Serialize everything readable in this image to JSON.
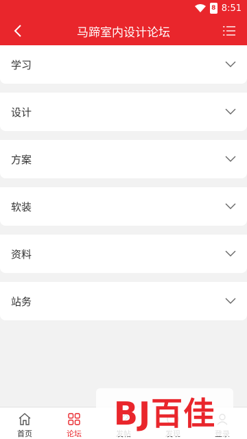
{
  "status_bar": {
    "time": "8:51",
    "battery": "8"
  },
  "header": {
    "title": "马蹄室内设计论坛"
  },
  "categories": [
    {
      "label": "学习"
    },
    {
      "label": "设计"
    },
    {
      "label": "方案"
    },
    {
      "label": "软装"
    },
    {
      "label": "资料"
    },
    {
      "label": "站务"
    }
  ],
  "tabbar": {
    "items": [
      {
        "label": "首页",
        "icon": "home-icon"
      },
      {
        "label": "论坛",
        "icon": "grid-icon"
      },
      {
        "label": "发帖",
        "icon": "post-icon"
      },
      {
        "label": "发现",
        "icon": "discover-icon"
      },
      {
        "label": "登录",
        "icon": "user-icon"
      }
    ],
    "active_index": 1
  },
  "watermark": {
    "text": "BJ百佳"
  },
  "colors": {
    "accent": "#e9262c",
    "background": "#f2f2f2"
  }
}
